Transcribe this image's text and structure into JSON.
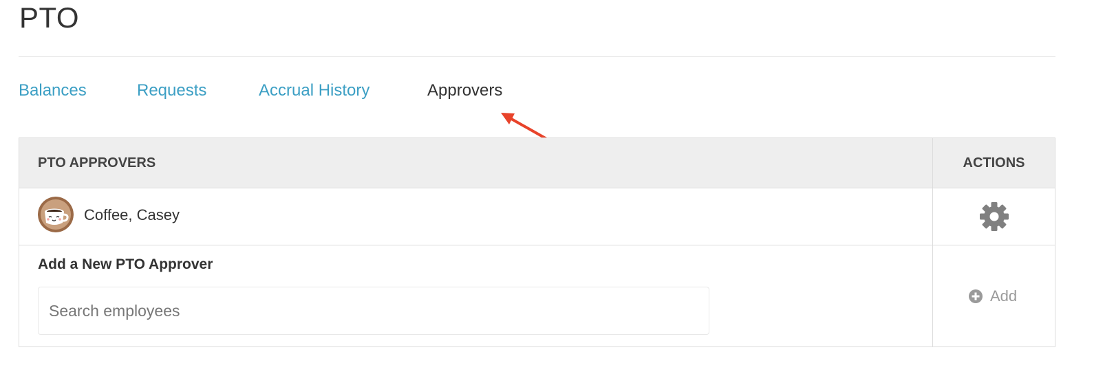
{
  "page": {
    "title": "PTO"
  },
  "tabs": [
    {
      "label": "Balances",
      "active": false
    },
    {
      "label": "Requests",
      "active": false
    },
    {
      "label": "Accrual History",
      "active": false
    },
    {
      "label": "Approvers",
      "active": true
    }
  ],
  "table": {
    "header_approvers": "PTO APPROVERS",
    "header_actions": "ACTIONS",
    "approvers": [
      {
        "name": "Coffee, Casey",
        "avatar_icon": "coffee-cup-avatar-icon",
        "action_icon": "gear-icon"
      }
    ],
    "add_section": {
      "label": "Add a New PTO Approver",
      "search_placeholder": "Search employees",
      "search_value": "",
      "add_button_label": "Add",
      "add_button_icon": "plus-circle-icon"
    }
  },
  "colors": {
    "link": "#3c9fc4",
    "active_tab": "#333333",
    "header_bg": "#eeeeee",
    "annotation_arrow": "#e8432a",
    "disabled_action": "#9a9a9a"
  }
}
